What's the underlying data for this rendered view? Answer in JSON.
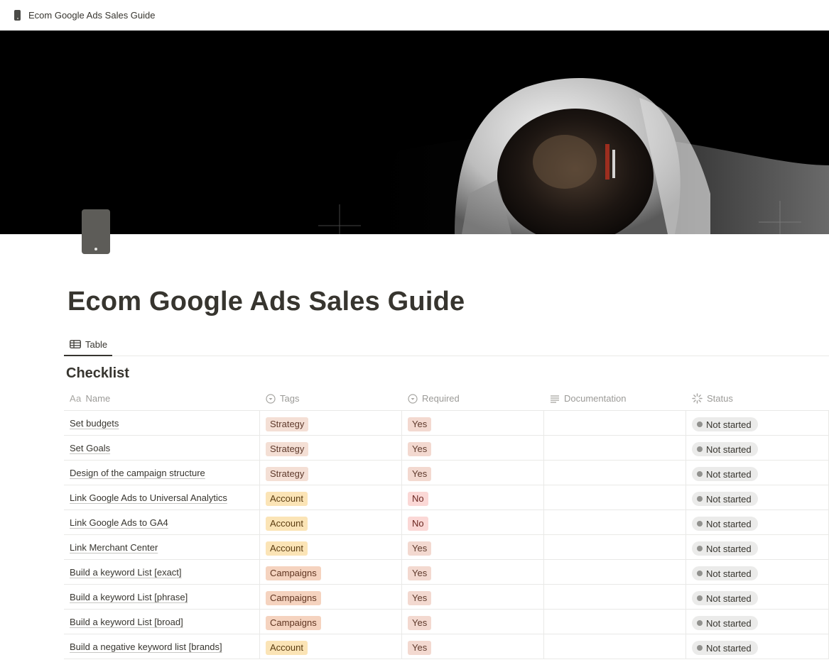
{
  "breadcrumb": {
    "title": "Ecom Google Ads Sales Guide",
    "icon": "mobile-phone-icon"
  },
  "cover": {
    "description_icon": "astronaut-cover-image"
  },
  "page": {
    "icon": "mobile-phone-icon",
    "title": "Ecom Google Ads Sales Guide"
  },
  "views": [
    {
      "label": "Table",
      "icon": "table-icon"
    }
  ],
  "database": {
    "title": "Checklist",
    "columns": [
      {
        "label": "Name",
        "icon": "text-aa-icon"
      },
      {
        "label": "Tags",
        "icon": "select-icon"
      },
      {
        "label": "Required",
        "icon": "select-icon"
      },
      {
        "label": "Documentation",
        "icon": "lines-icon"
      },
      {
        "label": "Status",
        "icon": "status-icon"
      }
    ],
    "rows": [
      {
        "name": "Set budgets",
        "tag": "Strategy",
        "required": "Yes",
        "documentation": "",
        "status": "Not started"
      },
      {
        "name": "Set Goals",
        "tag": "Strategy",
        "required": "Yes",
        "documentation": "",
        "status": "Not started"
      },
      {
        "name": "Design of the campaign structure",
        "tag": "Strategy",
        "required": "Yes",
        "documentation": "",
        "status": "Not started"
      },
      {
        "name": "Link Google Ads to Universal Analytics",
        "tag": "Account",
        "required": "No",
        "documentation": "",
        "status": "Not started"
      },
      {
        "name": "Link Google Ads to GA4",
        "tag": "Account",
        "required": "No",
        "documentation": "",
        "status": "Not started"
      },
      {
        "name": "Link Merchant Center",
        "tag": "Account",
        "required": "Yes",
        "documentation": "",
        "status": "Not started"
      },
      {
        "name": "Build a keyword List [exact]",
        "tag": "Campaigns",
        "required": "Yes",
        "documentation": "",
        "status": "Not started"
      },
      {
        "name": "Build a keyword List [phrase]",
        "tag": "Campaigns",
        "required": "Yes",
        "documentation": "",
        "status": "Not started"
      },
      {
        "name": "Build a keyword List [broad]",
        "tag": "Campaigns",
        "required": "Yes",
        "documentation": "",
        "status": "Not started"
      },
      {
        "name": "Build a negative keyword list [brands]",
        "tag": "Account",
        "required": "Yes",
        "documentation": "",
        "status": "Not started"
      }
    ]
  },
  "colors": {
    "text": "#37352f",
    "muted": "#9b9a97",
    "strategy_tag": "#f4dfd5",
    "account_tag": "#fbe4b6",
    "campaigns_tag": "#f5d3bf",
    "required_yes": "#f3d9d0",
    "required_no": "#fbd8d6",
    "status_bg": "#ebebea"
  }
}
